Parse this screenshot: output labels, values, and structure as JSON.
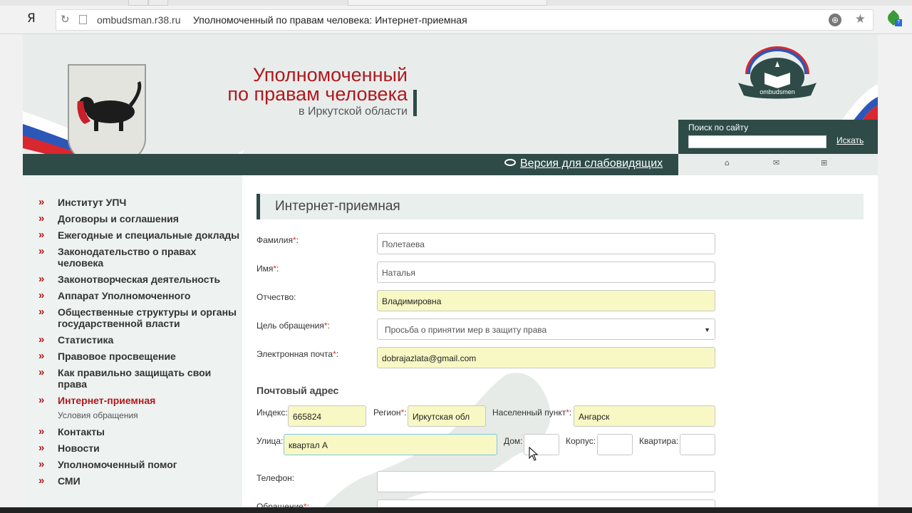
{
  "browser": {
    "logo": "Я",
    "domain": "ombudsman.r38.ru",
    "page_title": "Уполномоченный по правам человека: Интернет-приемная"
  },
  "header": {
    "title_line1": "Уполномоченный",
    "title_line2": "по правам человека",
    "title_line3": "в Иркутской области",
    "logo_text": "ombudsmen",
    "search_label": "Поиск по сайту",
    "search_button": "Искать",
    "vision_link": "Версия для слабовидящих"
  },
  "sidebar": {
    "items": [
      {
        "label": "Институт УПЧ"
      },
      {
        "label": "Договоры и соглашения"
      },
      {
        "label": "Ежегодные и специальные доклады"
      },
      {
        "label": "Законодательство о правах человека"
      },
      {
        "label": "Законотворческая деятельность"
      },
      {
        "label": "Аппарат Уполномоченного"
      },
      {
        "label": "Общественные структуры и органы государственной власти"
      },
      {
        "label": "Статистика"
      },
      {
        "label": "Правовое просвещение"
      },
      {
        "label": "Как правильно защищать свои права"
      },
      {
        "label": "Интернет-приемная"
      },
      {
        "label": "Контакты"
      },
      {
        "label": "Новости"
      },
      {
        "label": "Уполномоченный помог"
      },
      {
        "label": "СМИ"
      }
    ],
    "subitem": "Условия обращения"
  },
  "form": {
    "heading": "Интернет-приемная",
    "surname_label": "Фамилия",
    "surname_value": "Полетаева",
    "name_label": "Имя",
    "name_value": "Наталья",
    "patronymic_label": "Отчество:",
    "patronymic_value": "Владимировна",
    "purpose_label": "Цель обращения",
    "purpose_value": "Просьба о принятии мер в защиту права",
    "email_label": "Электронная почта",
    "email_value": "dobrajazlata@gmail.com",
    "postal_heading": "Почтовый адрес",
    "index_label": "Индекс:",
    "index_value": "665824",
    "region_label": "Регион",
    "region_value": "Иркутская обл",
    "locality_label": "Населенный пункт",
    "locality_value": "Ангарск",
    "street_label": "Улица:",
    "street_value": "квартал А",
    "house_label": "Дом:",
    "house_value": "",
    "building_label": "Корпус:",
    "apartment_label": "Квартира:",
    "phone_label": "Телефон:",
    "appeal_label": "Обращение"
  },
  "colors": {
    "brand_red": "#b0191d",
    "dark_green": "#2e4b47",
    "filled_bg": "#f8f8c5"
  }
}
